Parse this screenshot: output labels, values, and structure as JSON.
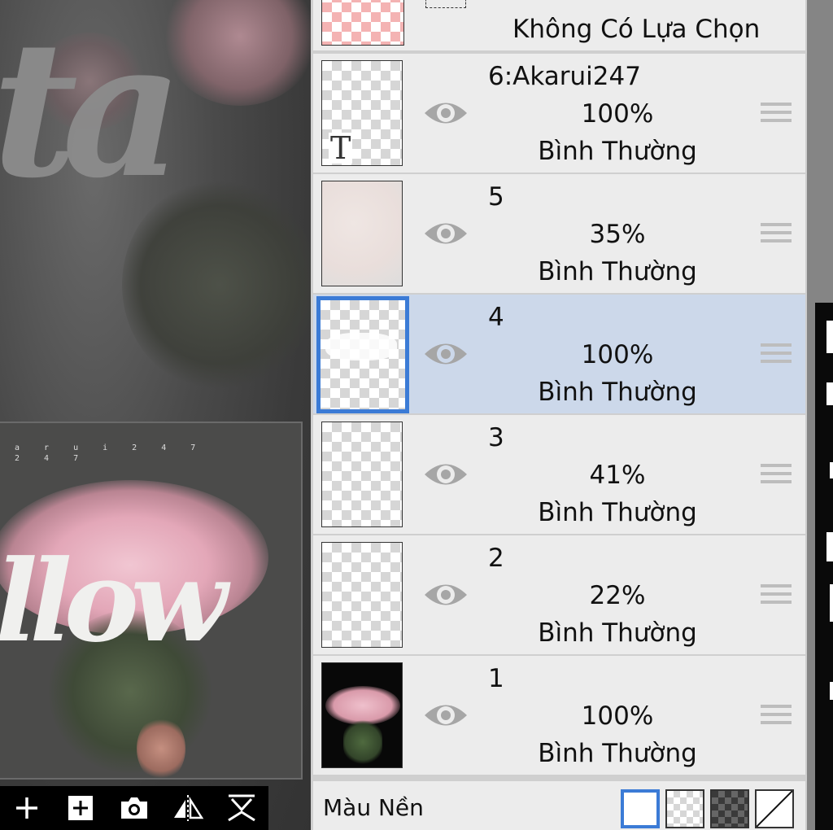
{
  "canvas": {
    "background_script": "ta",
    "preview": {
      "small_text_line1": "a r u i 2 4 7",
      "small_text_line2": "2 4 7",
      "script_word": "llow"
    },
    "bottom_toolbar": [
      {
        "name": "add-layer",
        "icon": "plus-icon"
      },
      {
        "name": "add-layer-box",
        "icon": "plus-box-icon"
      },
      {
        "name": "camera",
        "icon": "camera-icon"
      },
      {
        "name": "flip",
        "icon": "flip-icon"
      },
      {
        "name": "merge-down",
        "icon": "merge-down-icon"
      }
    ]
  },
  "layer_panel": {
    "selection_label": "Không Có Lựa Chọn",
    "layers": [
      {
        "name": "6:Akarui247",
        "opacity": "100%",
        "blend": "Bình Thường",
        "thumb": "text",
        "thumb_char": "T",
        "selected": false
      },
      {
        "name": "5",
        "opacity": "35%",
        "blend": "Bình Thường",
        "thumb": "texture",
        "selected": false
      },
      {
        "name": "4",
        "opacity": "100%",
        "blend": "Bình Thường",
        "thumb": "script",
        "selected": true
      },
      {
        "name": "3",
        "opacity": "41%",
        "blend": "Bình Thường",
        "thumb": "blank",
        "selected": false
      },
      {
        "name": "2",
        "opacity": "22%",
        "blend": "Bình Thường",
        "thumb": "blank",
        "selected": false
      },
      {
        "name": "1",
        "opacity": "100%",
        "blend": "Bình Thường",
        "thumb": "photo",
        "selected": false
      }
    ],
    "background": {
      "label": "Màu Nền",
      "swatches": [
        "white",
        "transparent",
        "dark-checker",
        "none"
      ],
      "selected_swatch": "white"
    }
  },
  "colors": {
    "accent": "#3b7bd6",
    "selected_row": "#ccd8ea",
    "row": "#ececec",
    "eye": "#a6a6a6"
  }
}
